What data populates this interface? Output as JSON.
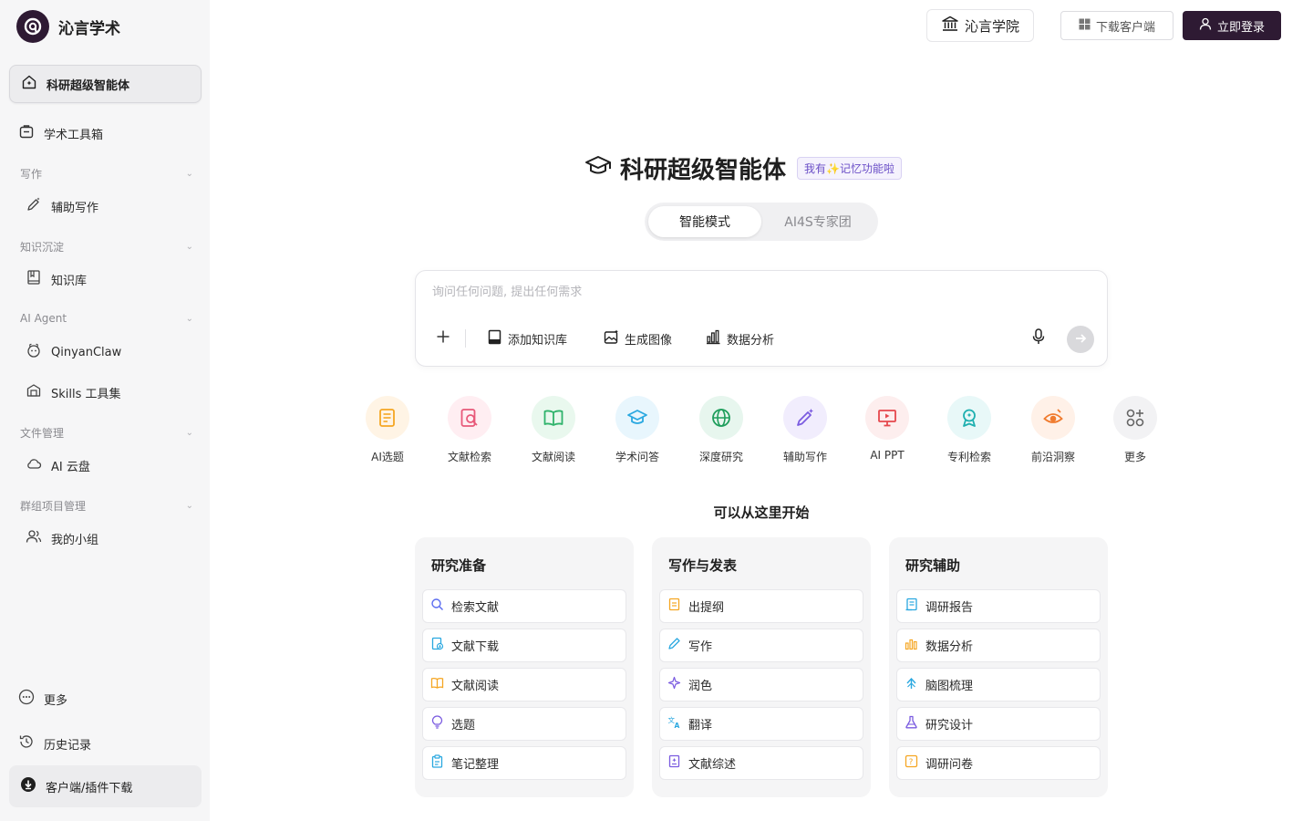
{
  "brand": {
    "name": "沁言学术"
  },
  "sidebar": {
    "primary": {
      "label": "科研超级智能体",
      "icon": "home-spark-icon"
    },
    "toolbox": {
      "label": "学术工具箱",
      "icon": "toolbox-icon"
    },
    "sections": [
      {
        "title": "写作",
        "items": [
          {
            "label": "辅助写作",
            "icon": "pen-sparkle-icon"
          }
        ]
      },
      {
        "title": "知识沉淀",
        "items": [
          {
            "label": "知识库",
            "icon": "book-icon"
          }
        ]
      },
      {
        "title": "AI Agent",
        "items": [
          {
            "label": "QinyanClaw",
            "icon": "claw-icon"
          },
          {
            "label": "Skills 工具集",
            "icon": "skills-box-icon"
          }
        ]
      },
      {
        "title": "文件管理",
        "items": [
          {
            "label": "AI 云盘",
            "icon": "cloud-icon"
          }
        ]
      },
      {
        "title": "群组项目管理",
        "items": [
          {
            "label": "我的小组",
            "icon": "group-icon"
          }
        ]
      }
    ],
    "more": {
      "label": "更多",
      "icon": "more-dots-icon"
    },
    "history": {
      "label": "历史记录",
      "icon": "history-icon"
    },
    "download": {
      "label": "客户端/插件下载",
      "icon": "download-icon"
    }
  },
  "header": {
    "academy": "沁言学院",
    "client_download": "下载客户端",
    "login": "立即登录"
  },
  "hero": {
    "title": "科研超级智能体",
    "badge": "我有✨记忆功能啦"
  },
  "modes": {
    "active": "智能模式",
    "other": "AI4S专家团"
  },
  "chat": {
    "placeholder": "询问任何问题, 提出任何需求",
    "value": "",
    "tools": [
      {
        "label": "添加知识库",
        "icon": "knowledge-base-icon"
      },
      {
        "label": "生成图像",
        "icon": "image-gen-icon"
      },
      {
        "label": "数据分析",
        "icon": "bar-chart-icon"
      }
    ]
  },
  "apps": [
    {
      "label": "AI选题",
      "icon": "topic-icon",
      "bg": "#fff4e5",
      "color": "#f5a623"
    },
    {
      "label": "文献检索",
      "icon": "literature-search-icon",
      "bg": "#ffeef2",
      "color": "#e8597a"
    },
    {
      "label": "文献阅读",
      "icon": "open-book-icon",
      "bg": "#e9f8ee",
      "color": "#2fb36b"
    },
    {
      "label": "学术问答",
      "icon": "graduation-cap-icon",
      "bg": "#e8f6fd",
      "color": "#2aa8e0"
    },
    {
      "label": "深度研究",
      "icon": "globe-icon",
      "bg": "#e7f6ee",
      "color": "#1f9e5c"
    },
    {
      "label": "辅助写作",
      "icon": "magic-pen-icon",
      "bg": "#f1edfd",
      "color": "#7b5ce0"
    },
    {
      "label": "AI PPT",
      "icon": "presentation-icon",
      "bg": "#fdeeee",
      "color": "#e5484d"
    },
    {
      "label": "专利检索",
      "icon": "patent-badge-icon",
      "bg": "#e8f8f8",
      "color": "#1fb0b0"
    },
    {
      "label": "前沿洞察",
      "icon": "insight-eye-icon",
      "bg": "#fff1e8",
      "color": "#f07b2e"
    },
    {
      "label": "更多",
      "icon": "more-grid-icon",
      "bg": "#f2f2f4",
      "color": "#666666"
    }
  ],
  "start_title": "可以从这里开始",
  "cards": [
    {
      "title": "研究准备",
      "items": [
        {
          "label": "检索文献",
          "icon": "search-icon",
          "color": "#5b6cf0"
        },
        {
          "label": "文献下载",
          "icon": "file-download-icon",
          "color": "#2aa8e0"
        },
        {
          "label": "文献阅读",
          "icon": "book-open-icon",
          "color": "#f5a623"
        },
        {
          "label": "选题",
          "icon": "bulb-icon",
          "color": "#7b5ce0"
        },
        {
          "label": "笔记整理",
          "icon": "clipboard-icon",
          "color": "#2aa8e0"
        }
      ]
    },
    {
      "title": "写作与发表",
      "items": [
        {
          "label": "出提纲",
          "icon": "outline-icon",
          "color": "#f5a623"
        },
        {
          "label": "写作",
          "icon": "pencil-icon",
          "color": "#2aa8e0"
        },
        {
          "label": "润色",
          "icon": "sparkle-icon",
          "color": "#7b5ce0"
        },
        {
          "label": "翻译",
          "icon": "translate-icon",
          "color": "#2aa8e0"
        },
        {
          "label": "文献综述",
          "icon": "review-doc-icon",
          "color": "#7b5ce0"
        }
      ]
    },
    {
      "title": "研究辅助",
      "items": [
        {
          "label": "调研报告",
          "icon": "report-icon",
          "color": "#2aa8e0"
        },
        {
          "label": "数据分析",
          "icon": "bar-chart-icon",
          "color": "#f5a623"
        },
        {
          "label": "脑图梳理",
          "icon": "mindmap-icon",
          "color": "#2aa8e0"
        },
        {
          "label": "研究设计",
          "icon": "flask-icon",
          "color": "#7b5ce0"
        },
        {
          "label": "调研问卷",
          "icon": "questionnaire-icon",
          "color": "#f5a623"
        }
      ]
    }
  ]
}
